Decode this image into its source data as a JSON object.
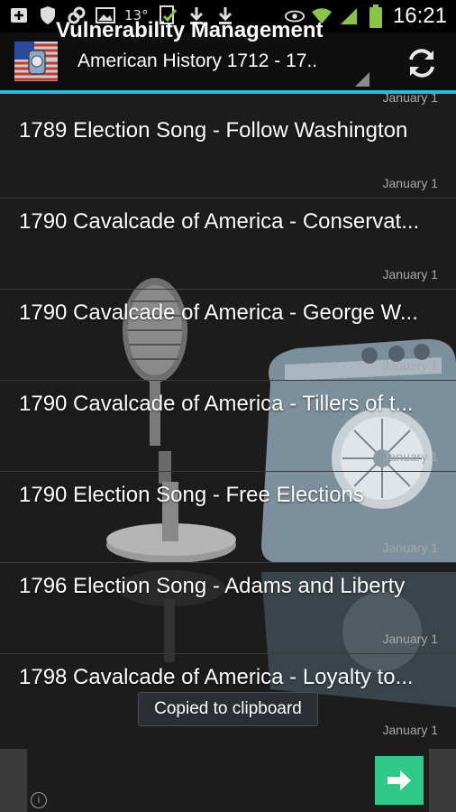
{
  "status_bar": {
    "temperature": "13°",
    "time": "16:21",
    "icons": [
      "add-box-icon",
      "shield-icon",
      "link-icon",
      "image-icon",
      "check-file-icon",
      "download-icon",
      "download-icon",
      "eye-icon",
      "wifi-icon",
      "signal-icon",
      "battery-icon"
    ]
  },
  "action_bar": {
    "title": "American History 1712 - 17..",
    "refresh_icon": "refresh-icon"
  },
  "list": {
    "top_partial_date": "January 1",
    "items": [
      {
        "title": "1789 Election Song - Follow Washington",
        "date": "January 1"
      },
      {
        "title": "1790 Cavalcade of America - Conservat...",
        "date": "January 1"
      },
      {
        "title": "1790 Cavalcade of America - George W...",
        "date": "January 1"
      },
      {
        "title": "1790 Cavalcade of America - Tillers of t...",
        "date": "January 1"
      },
      {
        "title": "1790 Election Song - Free Elections",
        "date": "January 1"
      },
      {
        "title": "1796 Election Song - Adams and Liberty",
        "date": "January 1"
      },
      {
        "title": "1798 Cavalcade of America - Loyalty to...",
        "date": "January 1"
      }
    ]
  },
  "toast": {
    "text": "Copied to clipboard"
  },
  "ad": {
    "text": "Vulnerability Management",
    "info": "i"
  },
  "colors": {
    "accent": "#33b5e5",
    "ad_button": "#2fc98a"
  }
}
